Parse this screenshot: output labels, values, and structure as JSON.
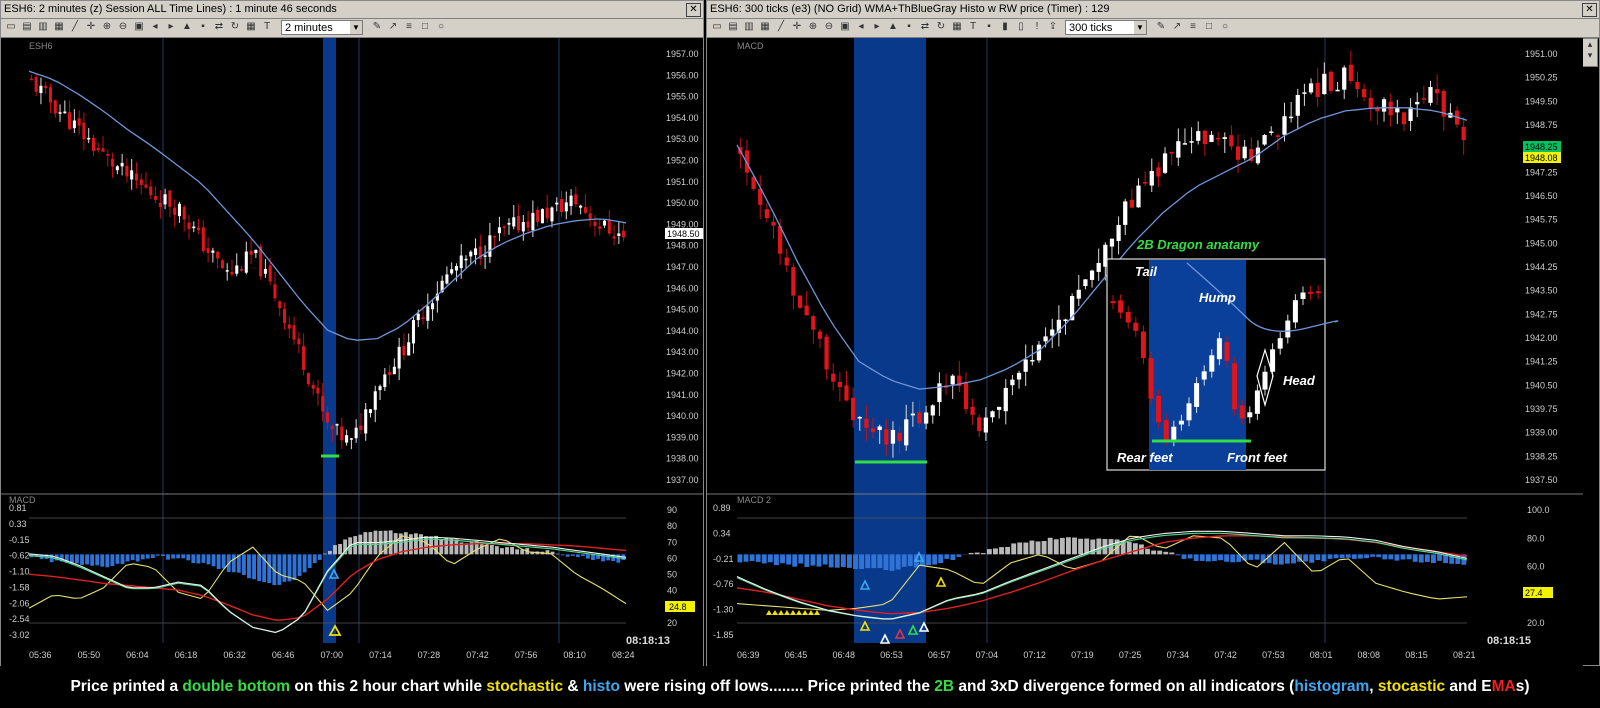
{
  "left_window": {
    "title": "ESH6: 2 minutes (z) Session  ALL  Time Lines) : 1 minute 46 seconds",
    "timeframe": "2 minutes",
    "close_icon": "close-icon",
    "price_panel_label": "ESH6",
    "indicator_label": "MACD",
    "clock": "08:18:13",
    "price_tag": "1948.50",
    "stoch_tag": "24.8"
  },
  "right_window": {
    "title": "ESH6: 300 ticks (e3) (NO Grid)  WMA+ThBlueGray Histo w RW price          (Timer) : 129",
    "timeframe": "300 ticks",
    "close_icon": "close-icon",
    "price_panel_label": "MACD",
    "indicator_label": "MACD 2",
    "clock": "08:18:15",
    "price_tag_1": "1948.25",
    "price_tag_2": "1948.08",
    "stoch_tag": "27.4",
    "inset": {
      "title": "2B Dragon anatamy",
      "tail": "Tail",
      "hump": "Hump",
      "head": "Head",
      "rear_feet": "Rear feet",
      "front_feet": "Front feet"
    }
  },
  "caption": {
    "p1": "Price printed a ",
    "p2": "double bottom",
    "p3": " on this  2 hour chart while ",
    "p4": "stochastic",
    "p5": " & ",
    "p6": "histo",
    "p7": " were rising off lows........ Price printed the ",
    "p8": "2B",
    "p9": "  and 3xD divergence formed  on all indicators (",
    "p10": "histogram",
    "p11": ", ",
    "p12": "stocastic",
    "p13": " and E",
    "p14": "MA",
    "p15": "s)"
  },
  "colors": {
    "up": "#ffffff",
    "down": "#e0151b",
    "ema": "#6f95d8",
    "histo_neg": "#2f73d6",
    "histo_pos": "#b8b8b8",
    "stoch": "#e8e070",
    "macd_fast": "#f0f0f0",
    "macd_slow": "#e02020",
    "signal": "#50d890",
    "highlight": "#0a3f9a",
    "double_bottom": "#33dd44"
  },
  "chart_data": [
    {
      "type": "candlestick",
      "name_ref": "ESH6 2 minutes",
      "y_ticks": [
        "1957.00",
        "1956.00",
        "1955.00",
        "1954.00",
        "1953.00",
        "1952.00",
        "1951.00",
        "1950.00",
        "1949.00",
        "1948.00",
        "1947.00",
        "1946.00",
        "1945.00",
        "1944.00",
        "1943.00",
        "1942.00",
        "1941.00",
        "1940.00",
        "1939.00",
        "1938.00",
        "1937.00"
      ],
      "ylim": [
        1936.5,
        1957.5
      ],
      "x_ticks": [
        "05:36",
        "05:50",
        "06:04",
        "06:18",
        "06:32",
        "06:46",
        "07:00",
        "07:14",
        "07:28",
        "07:42",
        "07:56",
        "08:10",
        "08:24"
      ],
      "close_path": [
        1955.8,
        1954.6,
        1953.4,
        1952.2,
        1951.2,
        1950.4,
        1949.8,
        1948.0,
        1946.6,
        1947.6,
        1945.4,
        1942.6,
        1939.4,
        1938.6,
        1941.4,
        1943.0,
        1945.2,
        1946.8,
        1947.6,
        1948.6,
        1949.2,
        1949.6,
        1950.2,
        1949.0,
        1948.4
      ],
      "ema_path": [
        1956.3,
        1955.9,
        1955.2,
        1954.4,
        1953.5,
        1952.7,
        1951.8,
        1950.9,
        1949.6,
        1948.3,
        1946.8,
        1945.3,
        1944.0,
        1943.5,
        1943.6,
        1944.2,
        1945.2,
        1946.3,
        1947.4,
        1948.1,
        1948.6,
        1949.0,
        1949.2,
        1949.3,
        1949.1
      ],
      "macd_y_ticks": [
        "0.81",
        "0.33",
        "-0.15",
        "-0.62",
        "-1.10",
        "-1.58",
        "-2.06",
        "-2.54",
        "-3.02"
      ],
      "stoch_y_ticks": [
        "90",
        "80",
        "70",
        "60",
        "50",
        "40",
        "30",
        "20"
      ],
      "stoch_path": [
        22,
        34,
        30,
        40,
        62,
        58,
        36,
        30,
        62,
        76,
        52,
        46,
        20,
        36,
        68,
        86,
        80,
        60,
        74,
        84,
        72,
        70,
        52,
        40,
        26
      ],
      "macd_fast_path": [
        0.7,
        0.68,
        0.6,
        0.5,
        0.4,
        0.4,
        0.45,
        0.42,
        0.2,
        0.05,
        0.0,
        0.15,
        0.55,
        0.8,
        0.8,
        0.82,
        0.85,
        0.84,
        0.82,
        0.8,
        0.78,
        0.76,
        0.73,
        0.7,
        0.67
      ],
      "macd_slow_path": [
        0.52,
        0.5,
        0.47,
        0.44,
        0.42,
        0.4,
        0.38,
        0.33,
        0.25,
        0.16,
        0.11,
        0.14,
        0.3,
        0.52,
        0.65,
        0.72,
        0.76,
        0.78,
        0.79,
        0.79,
        0.79,
        0.78,
        0.77,
        0.75,
        0.73
      ],
      "histo_path": [
        -0.3,
        -0.6,
        -0.9,
        -1.0,
        -0.6,
        -0.2,
        -0.4,
        -0.8,
        -1.4,
        -2.0,
        -2.6,
        -1.8,
        0.2,
        1.6,
        2.0,
        1.8,
        1.6,
        1.2,
        1.0,
        0.6,
        0.4,
        0.2,
        -0.2,
        -0.4,
        -0.6
      ]
    },
    {
      "type": "candlestick",
      "name_ref": "ESH6 300 ticks",
      "y_ticks": [
        "1951.00",
        "1950.25",
        "1949.50",
        "1948.75",
        "1948.00",
        "1947.25",
        "1946.50",
        "1945.75",
        "1945.00",
        "1944.25",
        "1943.50",
        "1942.75",
        "1942.00",
        "1941.25",
        "1940.50",
        "1939.75",
        "1939.00",
        "1938.25",
        "1937.50"
      ],
      "ylim": [
        1937.1,
        1951.4
      ],
      "x_ticks": [
        "06:39",
        "06:45",
        "06:48",
        "06:53",
        "06:57",
        "07:04",
        "07:12",
        "07:19",
        "07:25",
        "07:34",
        "07:42",
        "07:53",
        "08:01",
        "08:08",
        "08:15",
        "08:21"
      ],
      "close_path": [
        1948.0,
        1945.6,
        1943.0,
        1941.0,
        1939.0,
        1938.6,
        1939.4,
        1940.8,
        1939.0,
        1940.4,
        1941.6,
        1943.2,
        1944.8,
        1946.4,
        1947.6,
        1948.4,
        1948.2,
        1947.8,
        1949.0,
        1950.0,
        1950.4,
        1949.6,
        1949.2,
        1949.8,
        1948.2
      ],
      "ema_path": [
        1948.2,
        1946.4,
        1944.4,
        1942.6,
        1941.2,
        1940.6,
        1940.3,
        1940.4,
        1940.6,
        1941.0,
        1941.6,
        1942.6,
        1943.8,
        1945.0,
        1946.0,
        1946.8,
        1947.3,
        1947.8,
        1948.5,
        1949.0,
        1949.3,
        1949.4,
        1949.4,
        1949.3,
        1949.0
      ],
      "macd_y_ticks": [
        "0.89",
        "0.34",
        "-0.21",
        "-0.76",
        "-1.30",
        "-1.85"
      ],
      "stoch_y_ticks": [
        "100.0",
        "80.0",
        "60.0",
        "40.0",
        "20.0"
      ],
      "stoch_path": [
        26,
        24,
        22,
        20,
        22,
        26,
        60,
        56,
        42,
        62,
        70,
        56,
        64,
        88,
        74,
        86,
        84,
        56,
        80,
        52,
        68,
        44,
        36,
        30,
        32
      ],
      "macd_fast_path": [
        0.5,
        0.38,
        0.28,
        0.2,
        0.15,
        0.12,
        0.18,
        0.3,
        0.35,
        0.46,
        0.56,
        0.66,
        0.76,
        0.84,
        0.88,
        0.9,
        0.9,
        0.88,
        0.86,
        0.86,
        0.85,
        0.82,
        0.76,
        0.72,
        0.66
      ],
      "macd_slow_path": [
        0.4,
        0.36,
        0.3,
        0.24,
        0.2,
        0.17,
        0.18,
        0.22,
        0.28,
        0.36,
        0.45,
        0.55,
        0.64,
        0.72,
        0.8,
        0.84,
        0.86,
        0.86,
        0.85,
        0.84,
        0.83,
        0.8,
        0.76,
        0.72,
        0.68
      ],
      "histo_path": [
        -0.6,
        -0.8,
        -0.9,
        -1.0,
        -1.2,
        -1.3,
        -1.0,
        -0.4,
        0.2,
        0.8,
        1.2,
        1.4,
        1.3,
        1.0,
        0.2,
        -0.4,
        -0.6,
        -0.5,
        -0.8,
        -0.6,
        -0.4,
        -0.3,
        -0.5,
        -0.6,
        -0.8
      ]
    }
  ]
}
